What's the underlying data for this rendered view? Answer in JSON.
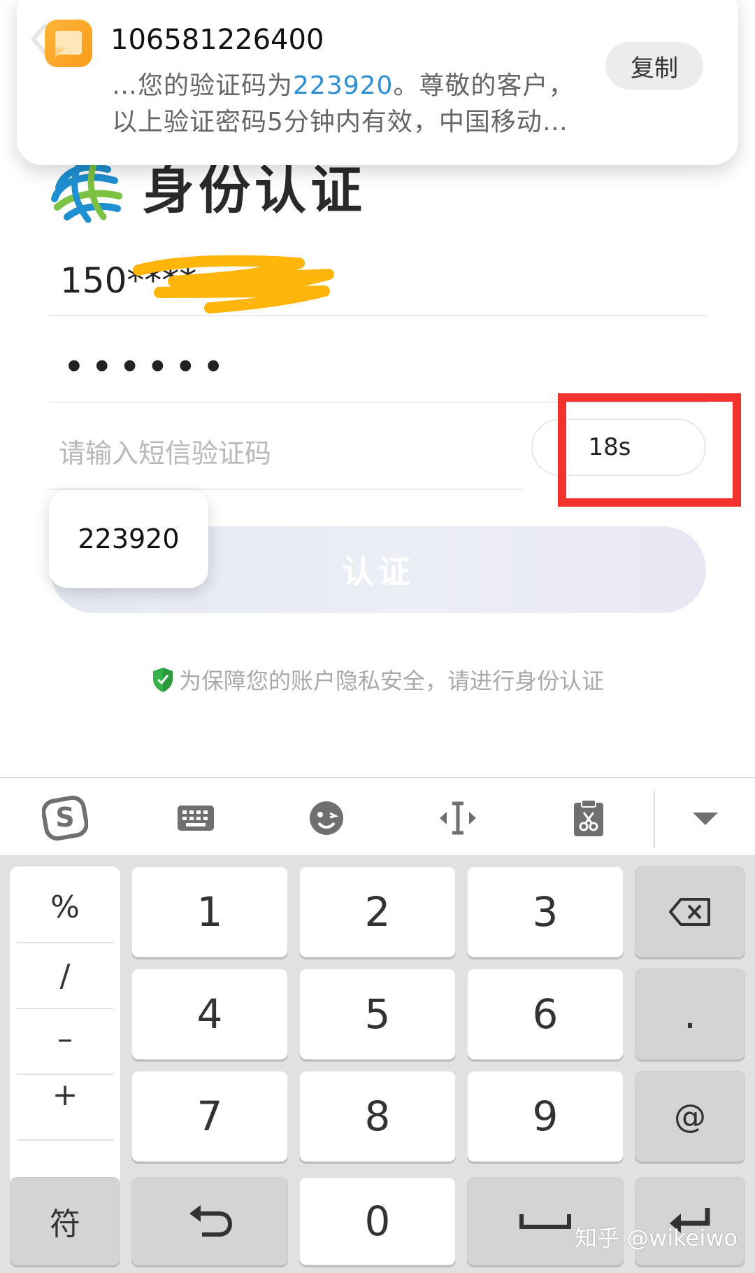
{
  "notification": {
    "sender": "106581226400",
    "line1_prefix": "…您的验证码为",
    "line1_code": "223920",
    "line1_suffix": "。尊敬的客户，",
    "line2": "以上验证密码5分钟内有效，中国移动…",
    "copy_label": "复制",
    "code_color": "#2b8fd6"
  },
  "page": {
    "title": "身份认证",
    "phone_masked": "150****",
    "password_mask": "••••••",
    "code_placeholder": "请输入短信验证码",
    "countdown": "18s",
    "submit_label": "认证",
    "suggestion_chip": "223920",
    "security_note": "为保障您的账户隐私安全，请进行身份认证"
  },
  "keyboard": {
    "toolbar": [
      "sogou-logo-icon",
      "keyboard-icon",
      "emoji-icon",
      "cursor-move-icon",
      "clipboard-icon",
      "collapse-chevron-icon"
    ],
    "side_symbols": [
      "%",
      "/",
      "–",
      "+"
    ],
    "digits": [
      "1",
      "2",
      "3",
      "4",
      "5",
      "6",
      "7",
      "8",
      "9",
      "0"
    ],
    "dot_key": ".",
    "at_key": "@",
    "symbols_key": "符"
  },
  "watermark": "知乎 @wikeiwo",
  "highlight_color": "#f1322d"
}
